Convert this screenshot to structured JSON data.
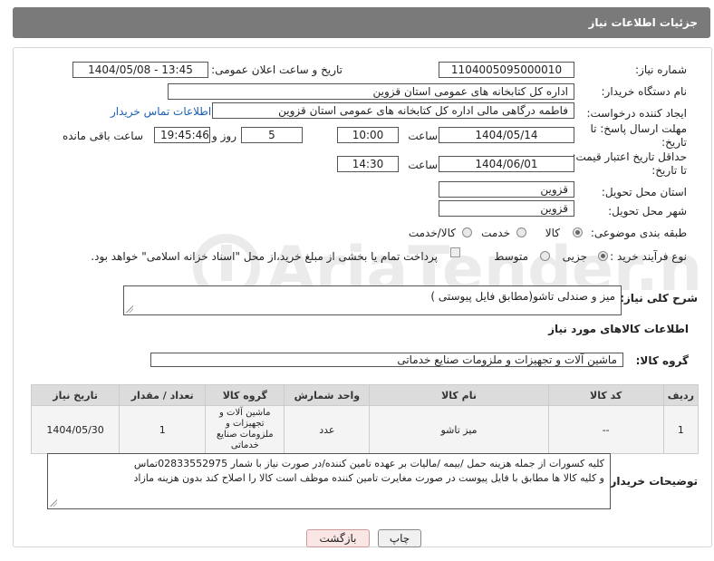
{
  "header": {
    "title": "جزئیات اطلاعات نیاز"
  },
  "fields": {
    "need_number_label": "شماره نیاز:",
    "need_number": "1104005095000010",
    "announce_label": "تاریخ و ساعت اعلان عمومی:",
    "announce_value": "1404/05/08 - 13:45",
    "buyer_org_label": "نام دستگاه خریدار:",
    "buyer_org": "اداره کل کتابخانه های عمومی استان قزوین",
    "creator_label": "ایجاد کننده درخواست:",
    "creator": "فاطمه درگاهی مالی اداره کل کتابخانه های عمومی استان قزوین",
    "contact_link": "اطلاعات تماس خریدار",
    "deadline_label": "مهلت ارسال پاسخ: تا تاریخ:",
    "deadline_date": "1404/05/14",
    "time_label": "ساعت",
    "deadline_time": "10:00",
    "days_value": "5",
    "days_label": "روز و",
    "remaining_time": "19:45:46",
    "remaining_label": "ساعت باقی مانده",
    "min_validity_label": "حداقل تاریخ اعتبار قیمت: تا تاریخ:",
    "validity_date": "1404/06/01",
    "validity_time": "14:30",
    "province_label": "استان محل تحویل:",
    "province": "قزوین",
    "city_label": "شهر محل تحویل:",
    "city": "قزوین",
    "category_label": "طبقه بندی موضوعی:",
    "category_options": [
      "کالا",
      "خدمت",
      "کالا/خدمت"
    ],
    "process_label": "نوع فرآیند خرید :",
    "process_options": [
      "جزیی",
      "متوسط"
    ],
    "payment_note": "پرداخت تمام یا بخشی از مبلغ خرید،از محل \"اسناد خزانه اسلامی\" خواهد بود."
  },
  "description": {
    "label": "شرح کلی نیاز:",
    "value": "میز و صندلی تاشو(مطابق فایل پیوستی )"
  },
  "goods": {
    "section_title": "اطلاعات کالاهای مورد نیاز",
    "group_label": "گروه کالا:",
    "group_value": "ماشین آلات و تجهیزات و ملزومات صنایع خدماتی",
    "columns": [
      "ردیف",
      "کد کالا",
      "نام کالا",
      "واحد شمارش",
      "گروه کالا",
      "تعداد / مقدار",
      "تاریخ نیاز"
    ],
    "rows": [
      {
        "row": "1",
        "code": "--",
        "name": "میز تاشو",
        "unit": "عدد",
        "group": "ماشین آلات و تجهیزات و ملزومات صنایع خدماتی",
        "qty": "1",
        "date": "1404/05/30"
      }
    ]
  },
  "buyer_notes": {
    "label": "توضیحات خریدار:",
    "line1": "کلیه کسورات از جمله هزینه حمل /بیمه /مالیات بر عهده تامین کننده/در صورت نیاز با شمار 02833552975تماس",
    "line2": "و کلیه کالا ها مطابق با فایل پیوست در صورت مغایرت تامین کننده موظف است کالا را اصلاح کند بدون هزینه مازاد"
  },
  "buttons": {
    "print": "چاپ",
    "back": "بازگشت"
  },
  "watermark": {
    "text": "AriaTender.net"
  }
}
